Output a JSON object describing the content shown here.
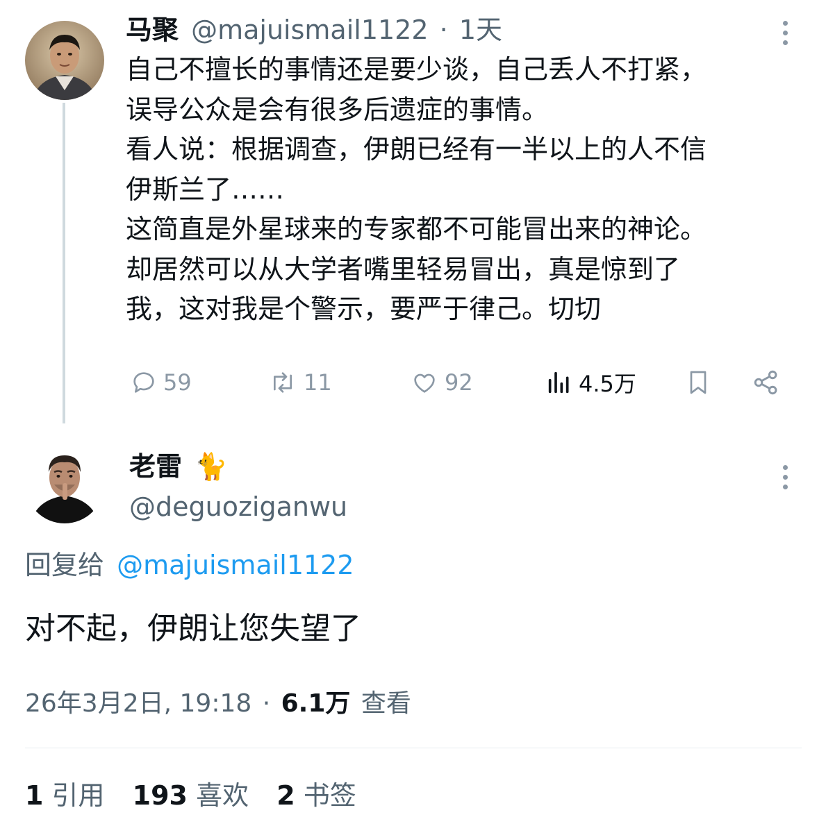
{
  "original_tweet": {
    "author_name": "马聚",
    "author_handle": "@majuismail1122",
    "separator": "·",
    "time": "1天",
    "text_lines": [
      "自己不擅长的事情还是要少谈，自己丢人不打紧，",
      "误导公众是会有很多后遗症的事情。",
      "看人说：根据调查，伊朗已经有一半以上的人不信",
      "伊斯兰了……",
      "这简直是外星球来的专家都不可能冒出来的神论。",
      "却居然可以从大学者嘴里轻易冒出，真是惊到了",
      "我，这对我是个警示，要严于律己。切切"
    ],
    "actions": {
      "reply_count": "59",
      "retweet_count": "11",
      "like_count": "92",
      "view_count": "4.5万"
    },
    "icons": [
      "reply-icon",
      "retweet-icon",
      "like-icon",
      "views-icon",
      "bookmark-icon",
      "share-icon",
      "more-icon"
    ]
  },
  "reply_tweet": {
    "author_name": "老雷",
    "author_emoji": "🐈",
    "author_handle": "@deguoziganwu",
    "replying_to_label": "回复给",
    "replying_to_handle": "@majuismail1122",
    "text": "对不起，伊朗让您失望了",
    "date": "26年3月2日, 19:18",
    "separator": "·",
    "views_value": "6.1万",
    "views_label": "查看",
    "stats": {
      "quotes_value": "1",
      "quotes_label": "引用",
      "likes_value": "193",
      "likes_label": "喜欢",
      "bookmarks_value": "2",
      "bookmarks_label": "书签"
    }
  },
  "colors": {
    "text": "#0f1419",
    "muted": "#536471",
    "icon": "#8b98a5",
    "link": "#1d9bf0",
    "thread_line": "#cfd9de"
  }
}
